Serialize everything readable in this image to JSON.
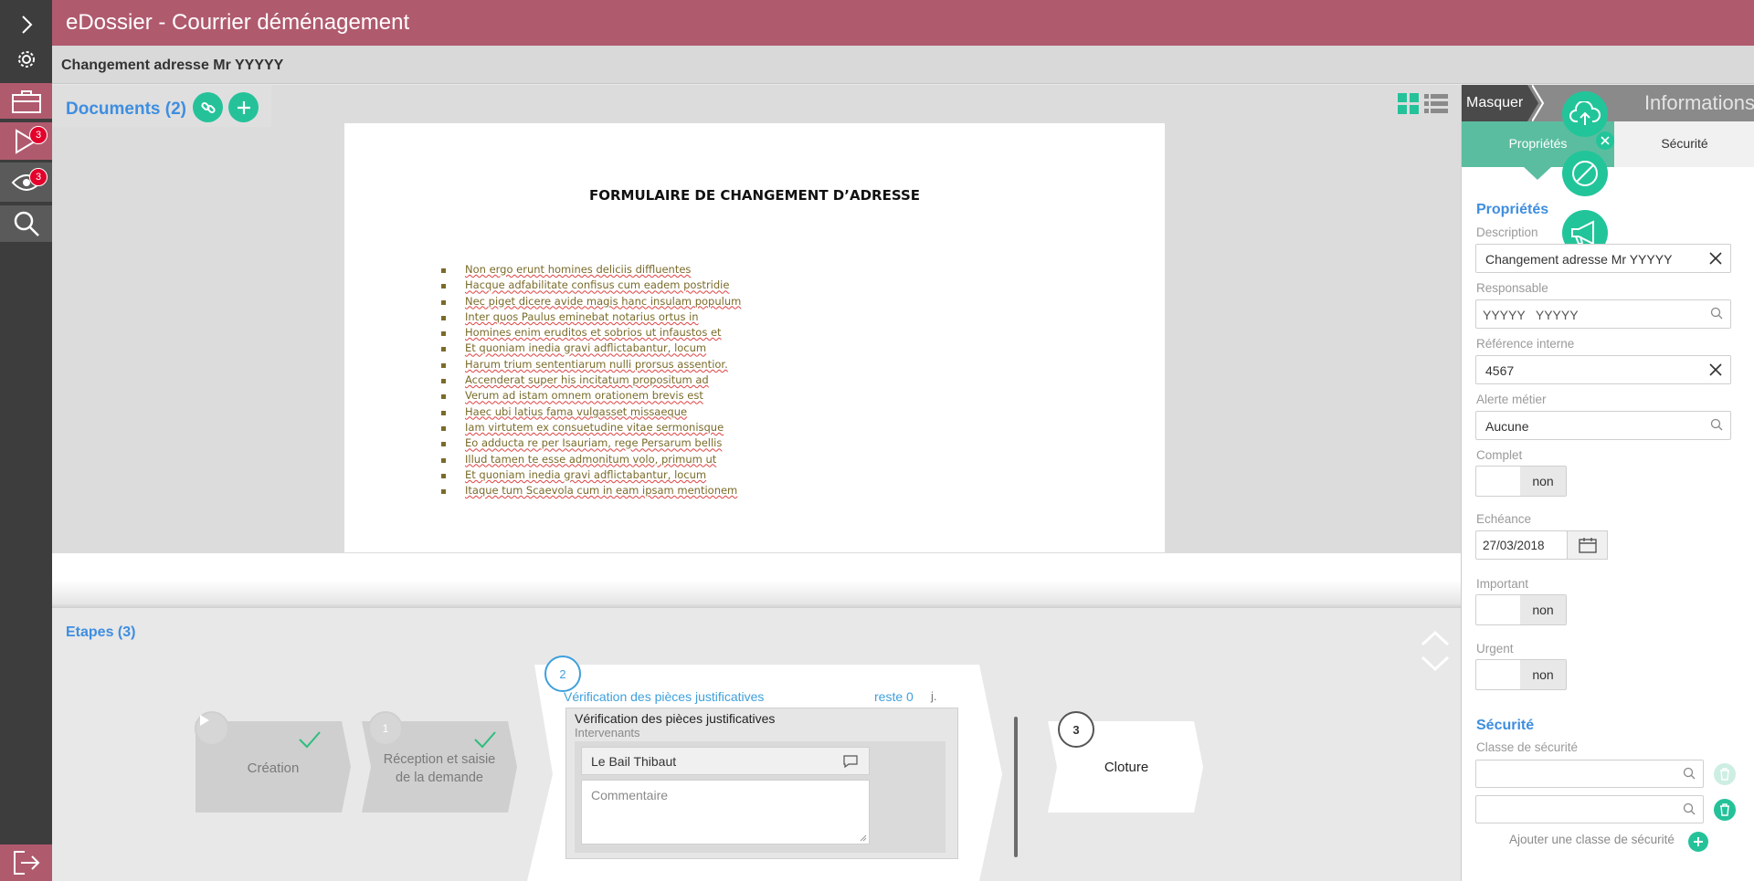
{
  "app": {
    "title": "eDossier - Courrier déménagement",
    "subtitle": "Changement adresse Mr YYYYY"
  },
  "rail": {
    "badges": {
      "tasks": "3",
      "watch": "3"
    }
  },
  "documents": {
    "title": "Documents (2)",
    "page_title": "FORMULAIRE DE CHANGEMENT D’ADRESSE",
    "lines": [
      "Non ergo erunt homines deliciis diffluentes",
      "Hacque adfabilitate confisus cum eadem postridie",
      "Nec piget dicere avide magis hanc insulam populum",
      "Inter quos Paulus eminebat notarius ortus in",
      "Homines enim eruditos et sobrios ut infaustos et",
      "Et quoniam inedia gravi adflictabantur, locum",
      "Harum trium sententiarum nulli prorsus assentior.",
      "Accenderat super his incitatum propositum ad",
      "Verum ad istam omnem orationem brevis est",
      "Haec ubi latius fama vulgasset missaeque",
      "Iam virtutem ex consuetudine vitae sermonisque",
      "Eo adducta re per Isauriam, rege Persarum bellis",
      "Illud tamen te esse admonitum volo, primum ut",
      "Et quoniam inedia gravi adflictabantur, locum",
      "Itaque tum Scaevola cum in eam ipsam mentionem"
    ]
  },
  "etapes": {
    "title": "Etapes (3)",
    "steps": [
      {
        "label": "Création"
      },
      {
        "number": "1",
        "label_line1": "Réception et saisie",
        "label_line2": "de la demande"
      },
      {
        "number": "2",
        "title": "Vérification des pièces justificatives",
        "remaining": "reste 0",
        "unit": "j.",
        "box_title": "Vérification des pièces justificatives",
        "box_sub": "Intervenants",
        "person": "Le Bail Thibaut",
        "comment_placeholder": "Commentaire"
      },
      {
        "number": "3",
        "label": "Cloture"
      }
    ]
  },
  "panel": {
    "masquer": "Masquer",
    "informations": "Informations",
    "tab_properties": "Propriétés",
    "tab_security": "Sécurité",
    "section_properties": "Propriétés",
    "description_label": "Description",
    "description_value": "Changement adresse Mr YYYYY",
    "responsable_label": "Responsable",
    "responsable_value": "YYYYY   YYYYY",
    "reference_label": "Référence interne",
    "reference_value": "4567",
    "alerte_label": "Alerte métier",
    "alerte_value": "Aucune",
    "complet_label": "Complet",
    "complet_value": "non",
    "echeance_label": "Echéance",
    "echeance_value": "27/03/2018",
    "important_label": "Important",
    "important_value": "non",
    "urgent_label": "Urgent",
    "urgent_value": "non",
    "section_security": "Sécurité",
    "classe_label": "Classe de sécurité",
    "add_class": "Ajouter une classe de sécurité"
  },
  "colors": {
    "brand": "#b05a6e",
    "accent_green": "#25c29a",
    "link_blue": "#3e8ee0"
  }
}
